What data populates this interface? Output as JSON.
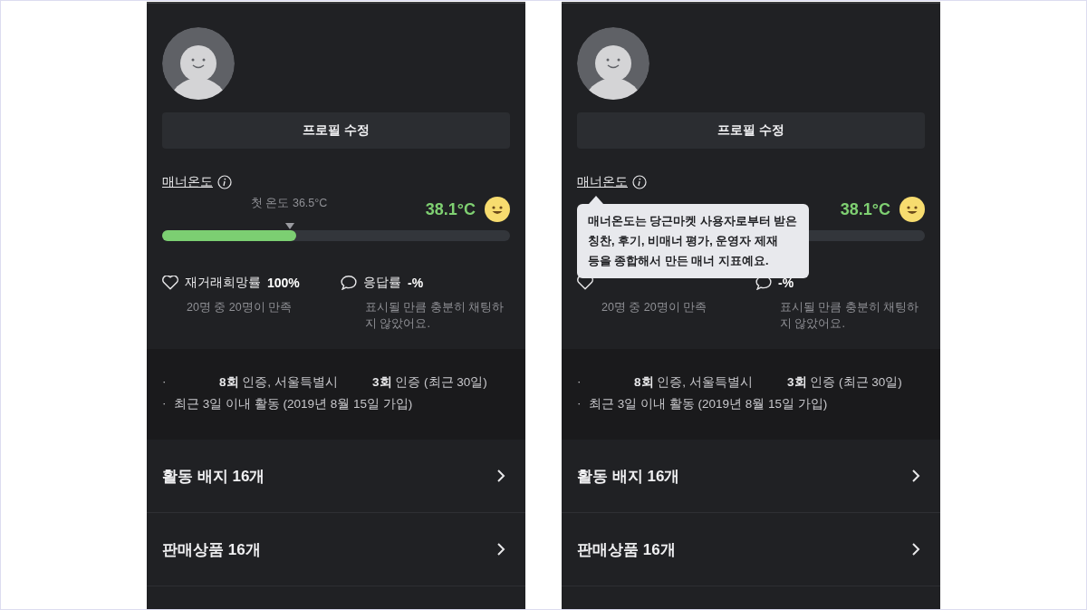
{
  "panels": [
    {
      "edit_button": "프로필 수정",
      "manner": {
        "label": "매너온도",
        "first_temp": "첫 온도 36.5°C",
        "temp": "38.1°C",
        "level": 0.385
      },
      "stats": [
        {
          "kind": "heart",
          "label": "재거래희망률",
          "value": "100%",
          "sub": "20명 중 20명이 만족"
        },
        {
          "kind": "chat",
          "label": "응답률",
          "value": "-%",
          "sub": "표시될 만큼 충분히 채팅하지 않았어요."
        }
      ],
      "bullets": [
        {
          "mark": "·",
          "parts": [
            "**8회** 인증, 서울특별시",
            "**3회** 인증 (최근 30일)"
          ]
        },
        {
          "mark": "·",
          "parts": [
            "최근 3일 이내 활동 (2019년 8월 15일 가입)"
          ]
        }
      ],
      "menu": [
        "활동 배지 16개",
        "판매상품 16개"
      ]
    },
    {
      "edit_button": "프로필 수정",
      "manner": {
        "label": "매너온도",
        "temp": "38.1°C"
      },
      "stats": [
        {
          "kind": "heart",
          "sub": "20명 중 20명이 만족"
        },
        {
          "kind": "chat",
          "value": "-%",
          "sub": "표시될 만큼 충분히 채팅하지 않았어요."
        }
      ],
      "bullets": [
        {
          "mark": "·",
          "parts": [
            "**8회** 인증, 서울특별시",
            "**3회** 인증 (최근 30일)"
          ]
        },
        {
          "mark": "·",
          "parts": [
            "최근 3일 이내 활동 (2019년 8월 15일 가입)"
          ]
        }
      ],
      "menu": [
        "활동 배지 16개",
        "판매상품 16개"
      ],
      "tooltip": [
        "매너온도는 당근마켓 사용자로부터 받은",
        "칭찬, 후기, 비매너 평가, 운영자 제재",
        "등을 종합해서 만든 매너 지표예요."
      ]
    }
  ]
}
